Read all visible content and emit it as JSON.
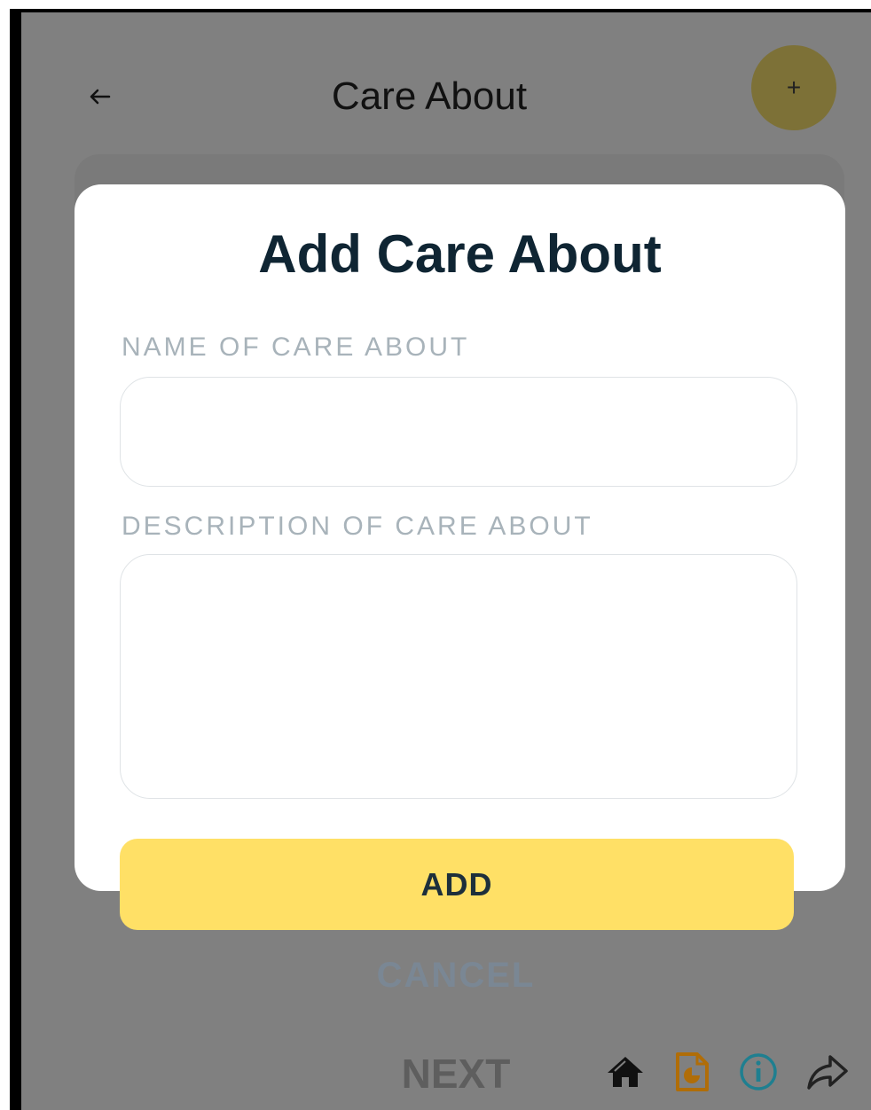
{
  "header": {
    "title": "Care About",
    "back_icon": "arrow-left-icon",
    "add_icon_glyph": "+"
  },
  "modal": {
    "title": "Add Care About",
    "name_label": "NAME OF CARE ABOUT",
    "name_value": "",
    "description_label": "DESCRIPTION OF CARE ABOUT",
    "description_value": "",
    "add_label": "ADD",
    "cancel_label": "CANCEL"
  },
  "footer": {
    "next_label": "NEXT",
    "icons": [
      "home-icon",
      "document-icon",
      "info-icon",
      "share-icon"
    ]
  },
  "colors": {
    "overlay": "#808080",
    "add_button": "#ffe066",
    "fab": "#7d7137",
    "title_text": "#0f2533",
    "doc_icon": "#b06d08",
    "info_icon": "#1f7f90"
  }
}
